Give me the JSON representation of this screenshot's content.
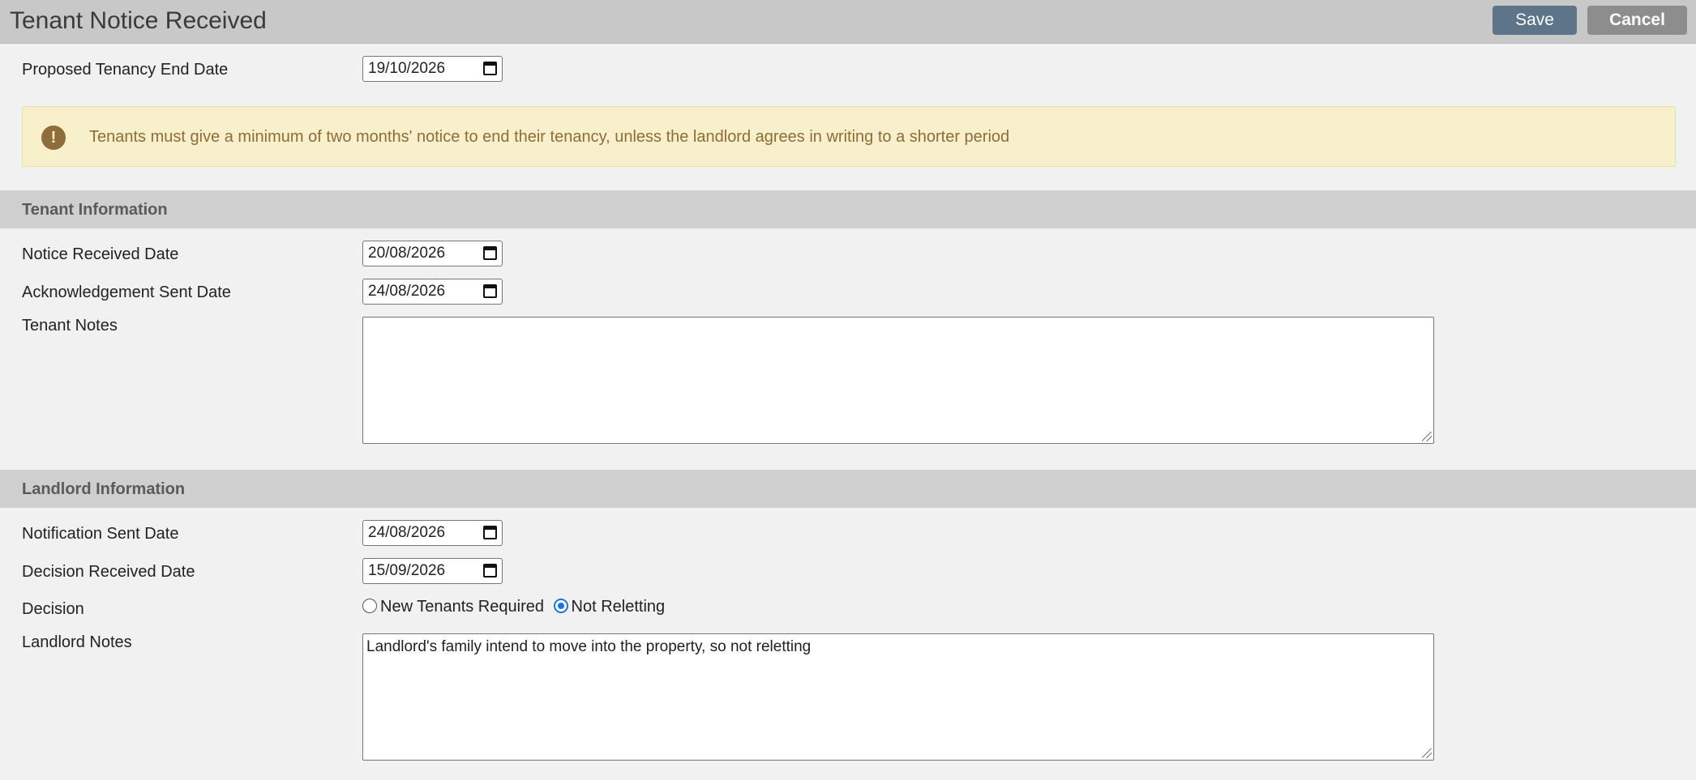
{
  "header": {
    "title": "Tenant Notice Received",
    "save_label": "Save",
    "cancel_label": "Cancel"
  },
  "proposed_end": {
    "label": "Proposed Tenancy End Date",
    "value": "19/10/2026"
  },
  "notice_banner": {
    "icon": "exclamation-icon",
    "text": "Tenants must give a minimum of two months' notice to end their tenancy, unless the landlord agrees in writing to a shorter period",
    "colors": {
      "background": "#f8f0cb",
      "text": "#8f6c3a"
    }
  },
  "tenant_section": {
    "title": "Tenant Information",
    "notice_received": {
      "label": "Notice Received Date",
      "value": "20/08/2026"
    },
    "ack_sent": {
      "label": "Acknowledgement Sent Date",
      "value": "24/08/2026"
    },
    "notes": {
      "label": "Tenant Notes",
      "value": ""
    }
  },
  "landlord_section": {
    "title": "Landlord Information",
    "notification_sent": {
      "label": "Notification Sent Date",
      "value": "24/08/2026"
    },
    "decision_received": {
      "label": "Decision Received Date",
      "value": "15/09/2026"
    },
    "decision": {
      "label": "Decision",
      "options": [
        "New Tenants Required",
        "Not Reletting"
      ],
      "selected": "Not Reletting"
    },
    "notes": {
      "label": "Landlord Notes",
      "value": "Landlord's family intend to move into the property, so not reletting"
    }
  },
  "colors": {
    "header_bg": "#c8c8c8",
    "save_button": "#5d7489",
    "cancel_button": "#8d8d8d",
    "section_bar": "#cfcfcf",
    "radio_accent": "#1a73e8"
  }
}
